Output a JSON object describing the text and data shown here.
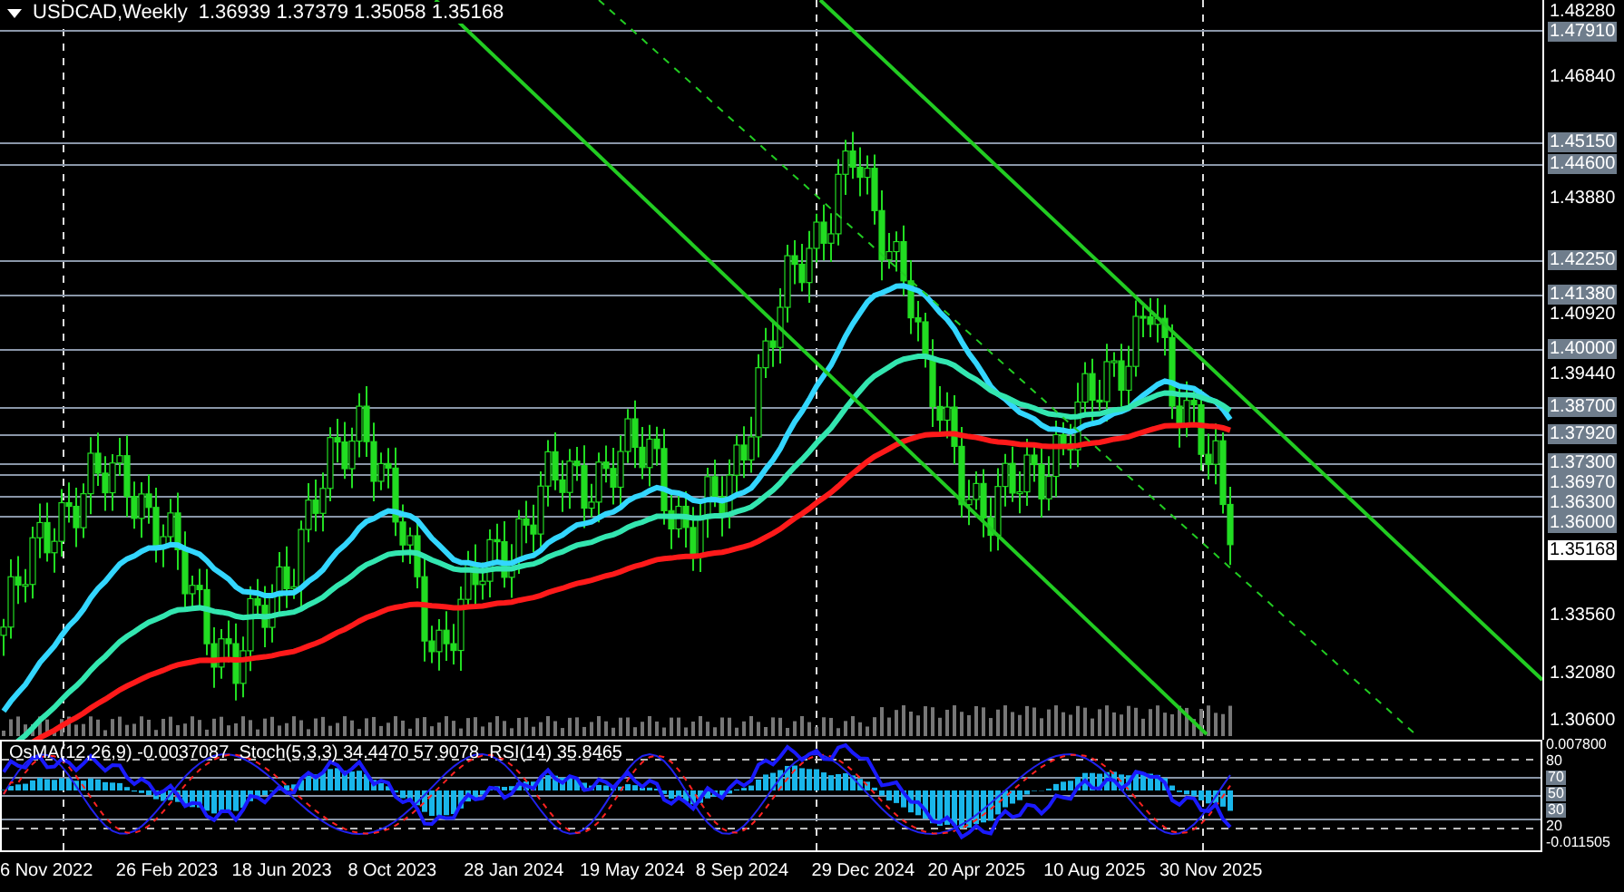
{
  "header": {
    "symbol": "USDCAD,Weekly",
    "values": "1.36939 1.37379 1.35058 1.35168"
  },
  "price_scale": [
    {
      "label": "1.48280",
      "kind": "tick"
    },
    {
      "label": "1.47910",
      "kind": "level"
    },
    {
      "label": "1.46840",
      "kind": "tick"
    },
    {
      "label": "1.45150",
      "kind": "level"
    },
    {
      "label": "1.44600",
      "kind": "level"
    },
    {
      "label": "1.43880",
      "kind": "tick"
    },
    {
      "label": "1.42250",
      "kind": "level"
    },
    {
      "label": "1.41380",
      "kind": "level"
    },
    {
      "label": "1.40920",
      "kind": "tick"
    },
    {
      "label": "1.40000",
      "kind": "level"
    },
    {
      "label": "1.39440",
      "kind": "tick"
    },
    {
      "label": "1.38700",
      "kind": "level"
    },
    {
      "label": "1.37920",
      "kind": "level"
    },
    {
      "label": "1.37300",
      "kind": "level"
    },
    {
      "label": "1.36970",
      "kind": "level"
    },
    {
      "label": "1.36300",
      "kind": "level"
    },
    {
      "label": "1.36000",
      "kind": "level"
    },
    {
      "label": "1.35168",
      "kind": "current"
    },
    {
      "label": "1.33560",
      "kind": "tick"
    },
    {
      "label": "1.32080",
      "kind": "tick"
    },
    {
      "label": "1.30600",
      "kind": "tick"
    }
  ],
  "indicator": {
    "title": "OsMA(12,26,9) -0.0037087  Stoch(5,3,3) 34.4470 57.9078  RSI(14) 35.8465",
    "scale": [
      {
        "label": "0.007800",
        "kind": "tick"
      },
      {
        "label": "80",
        "kind": "tick"
      },
      {
        "label": "70",
        "kind": "level"
      },
      {
        "label": "50",
        "kind": "level"
      },
      {
        "label": "30",
        "kind": "level"
      },
      {
        "label": "20",
        "kind": "tick"
      },
      {
        "label": "-0.011505",
        "kind": "tick"
      }
    ]
  },
  "time_axis": [
    "6 Nov 2022",
    "26 Feb 2023",
    "18 Jun 2023",
    "8 Oct 2023",
    "28 Jan 2024",
    "19 May 2024",
    "8 Sep 2024",
    "29 Dec 2024",
    "20 Apr 2025",
    "10 Aug 2025",
    "30 Nov 2025"
  ]
}
